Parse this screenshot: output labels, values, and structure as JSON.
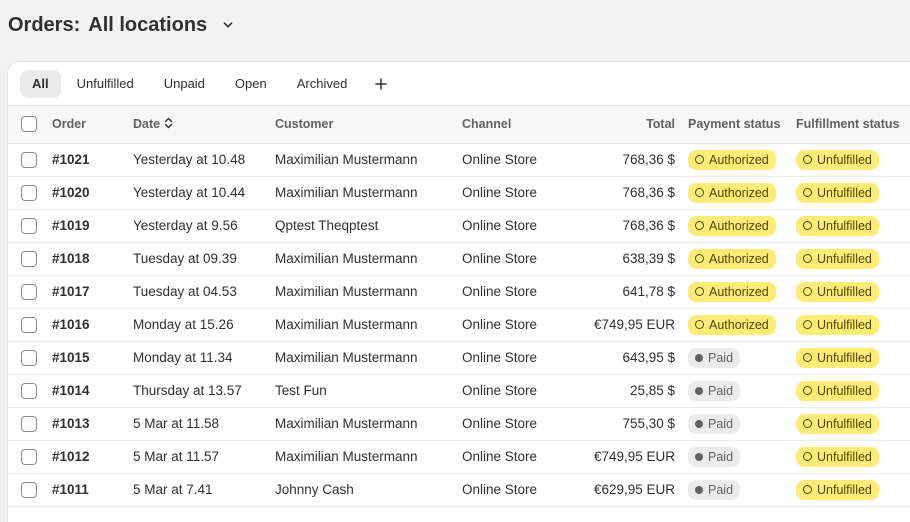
{
  "header": {
    "title": "Orders:",
    "location": "All locations"
  },
  "tabs": [
    {
      "label": "All",
      "active": true
    },
    {
      "label": "Unfulfilled",
      "active": false
    },
    {
      "label": "Unpaid",
      "active": false
    },
    {
      "label": "Open",
      "active": false
    },
    {
      "label": "Archived",
      "active": false
    }
  ],
  "columns": {
    "order": "Order",
    "date": "Date",
    "customer": "Customer",
    "channel": "Channel",
    "total": "Total",
    "payment": "Payment status",
    "fulfillment": "Fulfillment status"
  },
  "orders": [
    {
      "order": "#1021",
      "date": "Yesterday at 10.48",
      "customer": "Maximilian Mustermann",
      "channel": "Online Store",
      "total": "768,36 $",
      "payment": "Authorized",
      "fulfillment": "Unfulfilled"
    },
    {
      "order": "#1020",
      "date": "Yesterday at 10.44",
      "customer": "Maximilian Mustermann",
      "channel": "Online Store",
      "total": "768,36 $",
      "payment": "Authorized",
      "fulfillment": "Unfulfilled"
    },
    {
      "order": "#1019",
      "date": "Yesterday at 9.56",
      "customer": "Qptest Theqptest",
      "channel": "Online Store",
      "total": "768,36 $",
      "payment": "Authorized",
      "fulfillment": "Unfulfilled"
    },
    {
      "order": "#1018",
      "date": "Tuesday at 09.39",
      "customer": "Maximilian Mustermann",
      "channel": "Online Store",
      "total": "638,39 $",
      "payment": "Authorized",
      "fulfillment": "Unfulfilled"
    },
    {
      "order": "#1017",
      "date": "Tuesday at 04.53",
      "customer": "Maximilian Mustermann",
      "channel": "Online Store",
      "total": "641,78 $",
      "payment": "Authorized",
      "fulfillment": "Unfulfilled"
    },
    {
      "order": "#1016",
      "date": "Monday at 15.26",
      "customer": "Maximilian Mustermann",
      "channel": "Online Store",
      "total": "€749,95 EUR",
      "payment": "Authorized",
      "fulfillment": "Unfulfilled"
    },
    {
      "order": "#1015",
      "date": "Monday at 11.34",
      "customer": "Maximilian Mustermann",
      "channel": "Online Store",
      "total": "643,95 $",
      "payment": "Paid",
      "fulfillment": "Unfulfilled"
    },
    {
      "order": "#1014",
      "date": "Thursday at 13.57",
      "customer": "Test Fun",
      "channel": "Online Store",
      "total": "25,85 $",
      "payment": "Paid",
      "fulfillment": "Unfulfilled"
    },
    {
      "order": "#1013",
      "date": "5 Mar at 11.58",
      "customer": "Maximilian Mustermann",
      "channel": "Online Store",
      "total": "755,30 $",
      "payment": "Paid",
      "fulfillment": "Unfulfilled"
    },
    {
      "order": "#1012",
      "date": "5 Mar at 11.57",
      "customer": "Maximilian Mustermann",
      "channel": "Online Store",
      "total": "€749,95 EUR",
      "payment": "Paid",
      "fulfillment": "Unfulfilled"
    },
    {
      "order": "#1011",
      "date": "5 Mar at 7.41",
      "customer": "Johnny Cash",
      "channel": "Online Store",
      "total": "€629,95 EUR",
      "payment": "Paid",
      "fulfillment": "Unfulfilled"
    }
  ]
}
